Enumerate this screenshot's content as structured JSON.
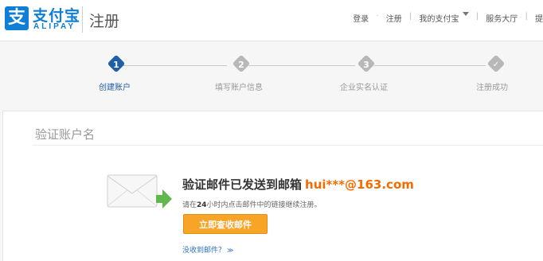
{
  "header": {
    "logo_glyph": "支",
    "brand_cn": "支付宝",
    "brand_en": "ALIPAY",
    "page_title": "注册",
    "nav": {
      "login": "登录",
      "dot": "·",
      "register": "注册",
      "divider": "|",
      "my_alipay": "我的支付宝",
      "service_hall": "服务大厅",
      "more": "提"
    }
  },
  "steps": [
    {
      "number": "1",
      "label": "创建账户",
      "state": "active"
    },
    {
      "number": "2",
      "label": "填写账户信息",
      "state": "pending"
    },
    {
      "number": "3",
      "label": "企业实名认证",
      "state": "pending"
    },
    {
      "number": "✓",
      "label": "注册成功",
      "state": "pending"
    }
  ],
  "main": {
    "section_title": "验证账户名",
    "message_title": "验证邮件已发送到邮箱",
    "email": "hui***@163.com",
    "sub_prefix": "请在",
    "sub_hours": "24",
    "sub_suffix": "小时内点击邮件中的链接继续注册。",
    "check_mail_button": "立即查收邮件",
    "not_received_link": "没收到邮件？",
    "not_received_chevron": "≫"
  },
  "colors": {
    "brand_blue": "#0f7ed5",
    "active_step": "#1f5fa6",
    "inactive_step": "#b8b8b8",
    "email_orange": "#f46b00",
    "button_orange": "#f8a427",
    "envelope_arrow": "#5fb84b"
  },
  "icons": {
    "envelope": "envelope-with-arrow-icon",
    "dropdown": "caret-down-icon",
    "complete": "check-icon"
  }
}
